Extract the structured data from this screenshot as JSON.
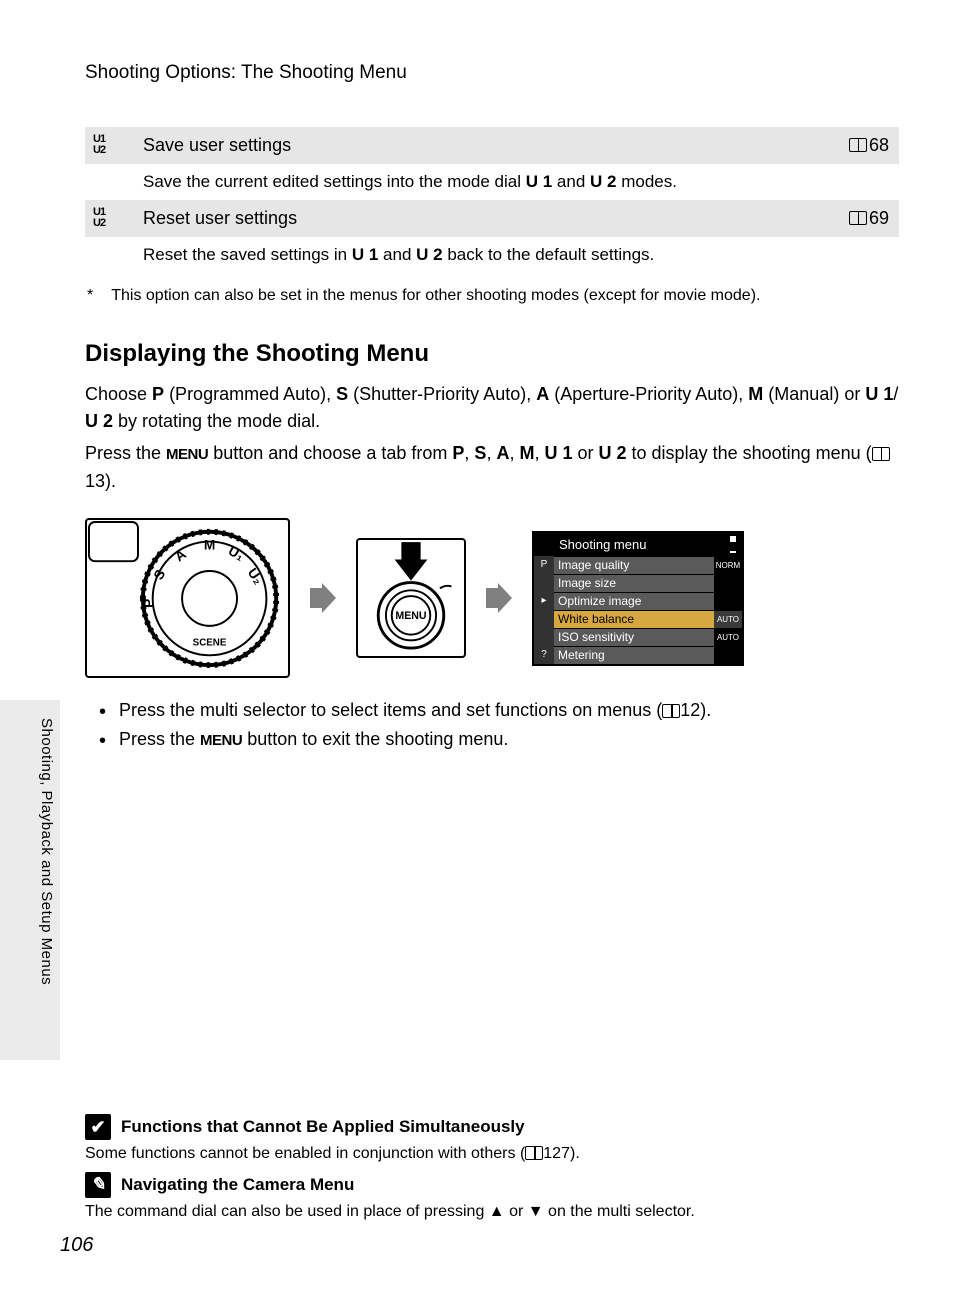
{
  "chapter_title": "Shooting Options: The Shooting Menu",
  "side_label": "Shooting, Playback and Setup Menus",
  "page_number": "106",
  "table": {
    "r1": {
      "icon": "U1\nU2",
      "title": "Save user settings",
      "ref": "68"
    },
    "r1_desc_a": "Save the current edited settings into the mode dial ",
    "r1_desc_b": " and ",
    "r1_desc_c": " modes.",
    "u1": "U 1",
    "u2": "U 2",
    "r2": {
      "icon": "U1\nU2",
      "title": "Reset user settings",
      "ref": "69"
    },
    "r2_desc_a": "Reset the saved settings in ",
    "r2_desc_b": " and ",
    "r2_desc_c": " back to the default settings."
  },
  "footnote_mark": "*",
  "footnote": "This option can also be set in the menus for other shooting modes (except for movie mode).",
  "section_heading": "Displaying the Shooting Menu",
  "para1_a": "Choose ",
  "p_sym": "P",
  "para1_b": " (Programmed Auto), ",
  "s_sym": "S",
  "para1_c": " (Shutter-Priority Auto), ",
  "a_sym": "A",
  "para1_d": " (Aperture-Priority Auto), ",
  "m_sym": "M",
  "para1_e": " (Manual) or ",
  "para1_f": "/",
  "para1_g": " by rotating the mode dial.",
  "para2_a": "Press the ",
  "menu_word": "MENU",
  "para2_b": " button and choose a tab from ",
  "comma": ", ",
  "or_word": " or ",
  "para2_c": " to display the shooting menu (",
  "para2_ref": "13",
  "para2_d": ").",
  "screen": {
    "title": "Shooting menu",
    "items": [
      "Image quality",
      "Image size",
      "Optimize image",
      "White balance",
      "ISO sensitivity",
      "Metering"
    ],
    "vals": [
      "NORM",
      "",
      "",
      "AUTO",
      "AUTO",
      ""
    ],
    "side": [
      "P",
      "",
      "▸",
      "",
      "",
      ""
    ]
  },
  "bul1_a": "Press the multi selector to select items and set functions on menus (",
  "bul1_ref": "12",
  "bul1_b": ").",
  "bul2_a": "Press the ",
  "bul2_b": " button to exit the shooting menu.",
  "note1_title": "Functions that Cannot Be Applied Simultaneously",
  "note1_body_a": "Some functions cannot be enabled in conjunction with others (",
  "note1_ref": "127",
  "note1_body_b": ").",
  "note2_title": "Navigating the Camera Menu",
  "note2_body_a": "The command dial can also be used in place of pressing ",
  "up_sym": "▲",
  "note2_body_b": " or ",
  "down_sym": "▼",
  "note2_body_c": " on the multi selector."
}
